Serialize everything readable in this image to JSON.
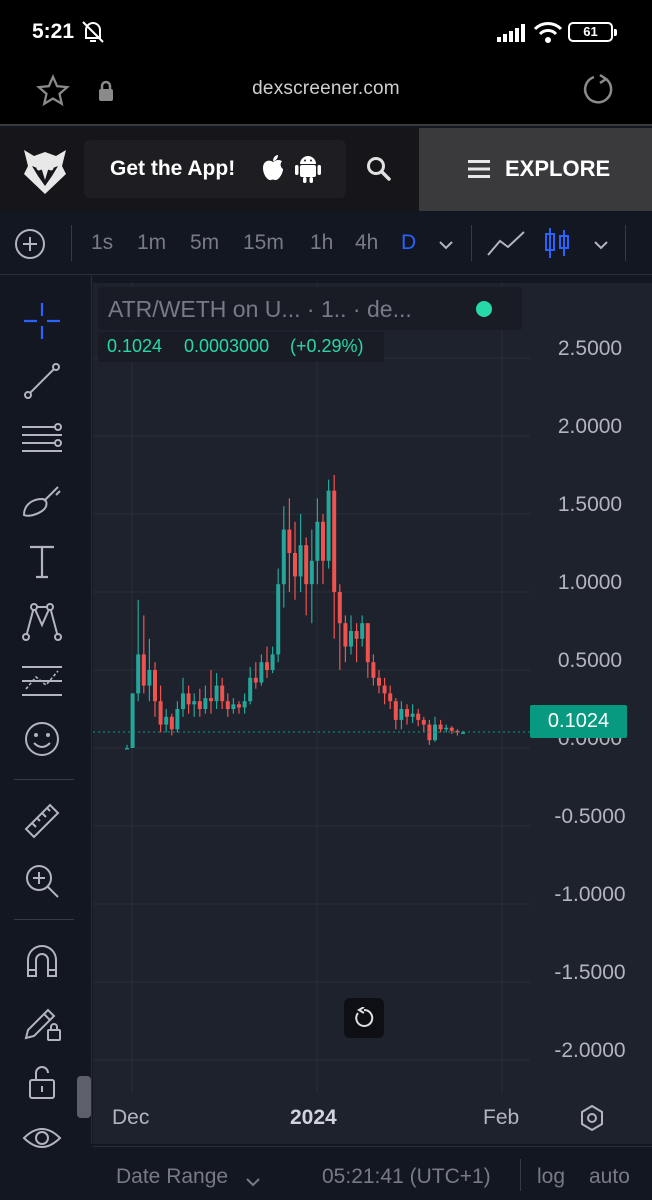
{
  "status_bar": {
    "time": "5:21",
    "battery": "61"
  },
  "browser": {
    "url": "dexscreener.com"
  },
  "site_header": {
    "get_app_label": "Get the App!",
    "explore_label": "EXPLORE"
  },
  "toolbar": {
    "timeframes": [
      "1s",
      "1m",
      "5m",
      "15m",
      "1h",
      "4h",
      "D"
    ],
    "active_timeframe": "D"
  },
  "legend": {
    "symbol": "ATR/WETH on U... · 1.. · de...",
    "last": "0.1024",
    "change": "0.0003000",
    "change_pct": "(+0.29%)"
  },
  "price_tag": "0.1024",
  "x_labels": [
    "Dec",
    "2024",
    "Feb"
  ],
  "bottom_bar": {
    "date_range": "Date Range",
    "clock": "05:21:41 (UTC+1)",
    "log": "log",
    "auto": "auto"
  },
  "colors": {
    "up": "#26a69a",
    "down": "#ef5350",
    "accent": "#2962ff",
    "price_tag": "#089981"
  },
  "chart_data": {
    "type": "candlestick",
    "title": "ATR/WETH",
    "ylim": [
      -2.2,
      2.7
    ],
    "y_ticks": [
      "2.5000",
      "2.0000",
      "1.5000",
      "1.0000",
      "0.5000",
      "0.0000",
      "-0.5000",
      "-1.0000",
      "-1.5000",
      "-2.0000"
    ],
    "y_tick_values": [
      2.5,
      2.0,
      1.5,
      1.0,
      0.5,
      0.0,
      -0.5,
      -1.0,
      -1.5,
      -2.0
    ],
    "last_price": 0.1024,
    "candles": [
      [
        0.0,
        0.0,
        0.02,
        0.0
      ],
      [
        0.0,
        0.35,
        0.35,
        0.0
      ],
      [
        0.35,
        0.6,
        0.95,
        0.3
      ],
      [
        0.6,
        0.4,
        0.85,
        0.35
      ],
      [
        0.4,
        0.5,
        0.7,
        0.3
      ],
      [
        0.5,
        0.3,
        0.55,
        0.2
      ],
      [
        0.3,
        0.15,
        0.4,
        0.1
      ],
      [
        0.15,
        0.2,
        0.25,
        0.1
      ],
      [
        0.2,
        0.12,
        0.22,
        0.08
      ],
      [
        0.12,
        0.25,
        0.3,
        0.1
      ],
      [
        0.25,
        0.35,
        0.45,
        0.2
      ],
      [
        0.35,
        0.28,
        0.4,
        0.22
      ],
      [
        0.28,
        0.3,
        0.35,
        0.2
      ],
      [
        0.3,
        0.25,
        0.38,
        0.2
      ],
      [
        0.25,
        0.32,
        0.4,
        0.22
      ],
      [
        0.32,
        0.3,
        0.5,
        0.22
      ],
      [
        0.3,
        0.4,
        0.48,
        0.25
      ],
      [
        0.4,
        0.3,
        0.45,
        0.25
      ],
      [
        0.3,
        0.25,
        0.35,
        0.2
      ],
      [
        0.25,
        0.28,
        0.32,
        0.22
      ],
      [
        0.28,
        0.26,
        0.3,
        0.22
      ],
      [
        0.26,
        0.3,
        0.35,
        0.22
      ],
      [
        0.3,
        0.45,
        0.52,
        0.28
      ],
      [
        0.45,
        0.42,
        0.55,
        0.38
      ],
      [
        0.42,
        0.55,
        0.6,
        0.4
      ],
      [
        0.55,
        0.5,
        0.65,
        0.45
      ],
      [
        0.5,
        0.6,
        0.65,
        0.48
      ],
      [
        0.6,
        1.05,
        1.15,
        0.55
      ],
      [
        1.05,
        1.4,
        1.55,
        0.9
      ],
      [
        1.4,
        1.25,
        1.6,
        1.0
      ],
      [
        1.25,
        1.1,
        1.45,
        0.95
      ],
      [
        1.1,
        1.3,
        1.5,
        1.0
      ],
      [
        1.3,
        1.05,
        1.35,
        0.85
      ],
      [
        1.05,
        1.2,
        1.4,
        0.8
      ],
      [
        1.2,
        1.45,
        1.6,
        1.05
      ],
      [
        1.45,
        1.2,
        1.5,
        1.05
      ],
      [
        1.2,
        1.65,
        1.72,
        1.15
      ],
      [
        1.65,
        1.0,
        1.75,
        0.7
      ],
      [
        1.0,
        0.8,
        1.05,
        0.5
      ],
      [
        0.8,
        0.65,
        0.85,
        0.55
      ],
      [
        0.65,
        0.75,
        0.85,
        0.6
      ],
      [
        0.75,
        0.7,
        0.8,
        0.55
      ],
      [
        0.7,
        0.8,
        0.85,
        0.65
      ],
      [
        0.8,
        0.55,
        0.8,
        0.45
      ],
      [
        0.55,
        0.45,
        0.6,
        0.4
      ],
      [
        0.45,
        0.4,
        0.5,
        0.35
      ],
      [
        0.4,
        0.35,
        0.45,
        0.28
      ],
      [
        0.35,
        0.3,
        0.4,
        0.25
      ],
      [
        0.3,
        0.18,
        0.32,
        0.12
      ],
      [
        0.18,
        0.25,
        0.3,
        0.12
      ],
      [
        0.25,
        0.2,
        0.28,
        0.15
      ],
      [
        0.2,
        0.22,
        0.28,
        0.16
      ],
      [
        0.22,
        0.18,
        0.25,
        0.14
      ],
      [
        0.18,
        0.15,
        0.2,
        0.1
      ],
      [
        0.15,
        0.05,
        0.18,
        0.02
      ],
      [
        0.05,
        0.15,
        0.2,
        0.04
      ],
      [
        0.15,
        0.12,
        0.18,
        0.1
      ],
      [
        0.12,
        0.13,
        0.15,
        0.1
      ],
      [
        0.13,
        0.11,
        0.14,
        0.09
      ],
      [
        0.11,
        0.1,
        0.12,
        0.08
      ],
      [
        0.1,
        0.1,
        0.11,
        0.09
      ]
    ]
  }
}
